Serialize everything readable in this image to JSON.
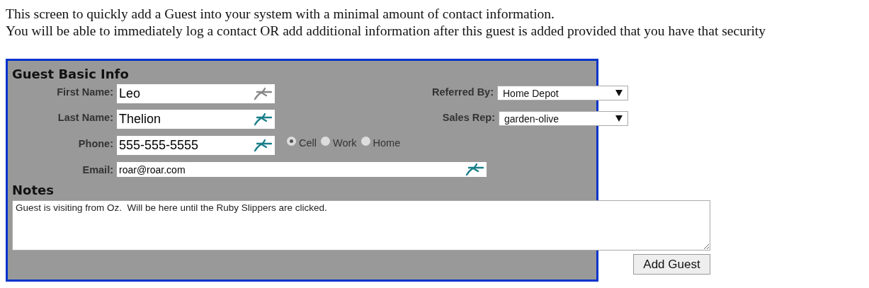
{
  "intro": [
    "This screen to quickly add a Guest into your system with a minimal amount of contact information.",
    "You will be able to immediately log a contact OR add additional information after this guest is added provided that you have that security"
  ],
  "panel": {
    "title": "Guest Basic Info",
    "fields": [
      {
        "label": "First Name:",
        "value": "Leo",
        "icon_active": false
      },
      {
        "label": "Last Name:",
        "value": "Thelion",
        "icon_active": true
      },
      {
        "label": "Phone:",
        "value": "555-555-5555",
        "icon_active": true
      }
    ],
    "phone_types": [
      {
        "label": "Cell",
        "selected": true
      },
      {
        "label": "Work",
        "selected": false
      },
      {
        "label": "Home",
        "selected": false
      }
    ],
    "email": {
      "label": "Email:",
      "value": "roar@roar.com",
      "icon_active": true
    },
    "dropdowns": [
      {
        "label": "Referred By:",
        "value": "Home Depot"
      },
      {
        "label": "Sales Rep:",
        "value": "garden-olive"
      }
    ],
    "notes": {
      "title": "Notes",
      "value": "Guest is visiting from Oz.  Will be here until the Ruby Slippers are clicked."
    },
    "button": "Add Guest"
  }
}
